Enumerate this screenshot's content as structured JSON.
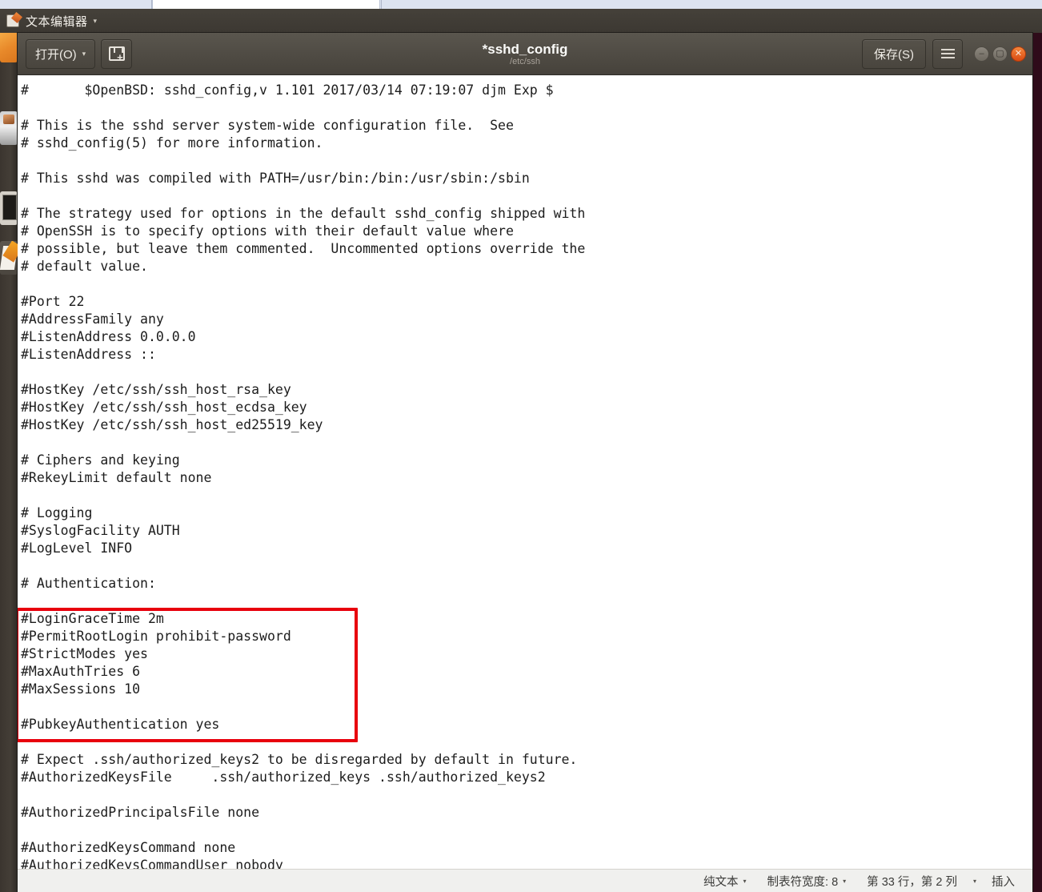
{
  "panel": {
    "app_icon": "text-editor-icon",
    "app_name": "文本编辑器",
    "caret": "▾"
  },
  "headerbar": {
    "open_label": "打开(O)",
    "open_caret": "▾",
    "save_icon_name": "save-as-icon",
    "save_label": "保存(S)",
    "menu_icon": "hamburger-menu-icon",
    "title": "*sshd_config",
    "subtitle": "/etc/ssh",
    "window_controls": {
      "minimize": "–",
      "maximize": "▢",
      "close": "✕"
    }
  },
  "launcher": {
    "items": [
      {
        "name": "files-icon"
      },
      {
        "name": "software-center-icon"
      },
      {
        "name": "terminal-icon"
      },
      {
        "name": "text-editor-icon"
      }
    ]
  },
  "document": {
    "filename": "sshd_config",
    "modified": true,
    "content": "#\t$OpenBSD: sshd_config,v 1.101 2017/03/14 07:19:07 djm Exp $\n\n# This is the sshd server system-wide configuration file.  See\n# sshd_config(5) for more information.\n\n# This sshd was compiled with PATH=/usr/bin:/bin:/usr/sbin:/sbin\n\n# The strategy used for options in the default sshd_config shipped with\n# OpenSSH is to specify options with their default value where\n# possible, but leave them commented.  Uncommented options override the\n# default value.\n\n#Port 22\n#AddressFamily any\n#ListenAddress 0.0.0.0\n#ListenAddress ::\n\n#HostKey /etc/ssh/ssh_host_rsa_key\n#HostKey /etc/ssh/ssh_host_ecdsa_key\n#HostKey /etc/ssh/ssh_host_ed25519_key\n\n# Ciphers and keying\n#RekeyLimit default none\n\n# Logging\n#SyslogFacility AUTH\n#LogLevel INFO\n\n# Authentication:\n\n#LoginGraceTime 2m\n#PermitRootLogin prohibit-password\n#StrictModes yes\n#MaxAuthTries 6\n#MaxSessions 10\n\n#PubkeyAuthentication yes\n\n# Expect .ssh/authorized_keys2 to be disregarded by default in future.\n#AuthorizedKeysFile\t.ssh/authorized_keys .ssh/authorized_keys2\n\n#AuthorizedPrincipalsFile none\n\n#AuthorizedKeysCommand none\n#AuthorizedKeysCommandUser nobody"
  },
  "annotation": {
    "name": "authentication-section-highlight",
    "color": "#e8000d",
    "covers": "# Authentication: through #MaxSessions 10"
  },
  "statusbar": {
    "language": "纯文本",
    "language_caret": "▾",
    "tab_width_label": "制表符宽度: 8",
    "tab_width_caret": "▾",
    "position": "第 33 行，第 2 列",
    "position_caret": "▾",
    "insert_mode": "插入"
  }
}
